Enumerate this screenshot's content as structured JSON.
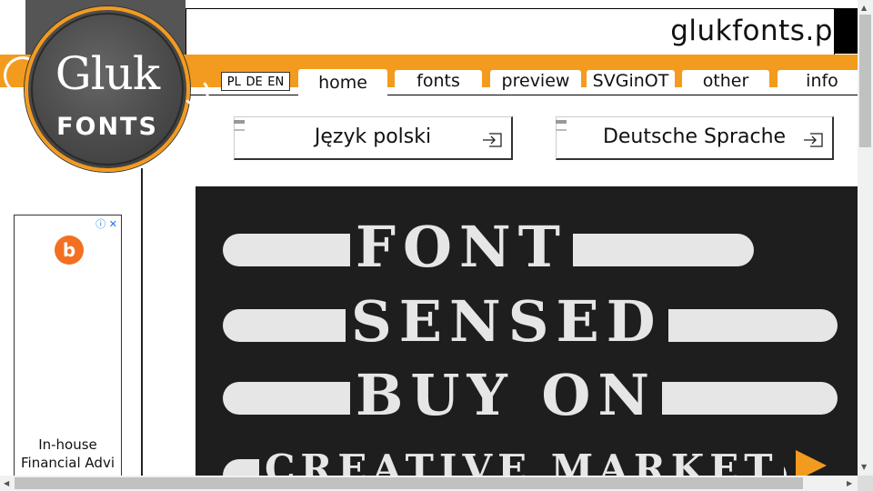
{
  "header": {
    "site_title": "glukfonts.p",
    "title_overflow": "pl"
  },
  "logo": {
    "word1": "Gluk",
    "word2": "FONTS"
  },
  "languages": [
    "PL",
    "DE",
    "EN"
  ],
  "tabs": [
    {
      "label": "home",
      "active": true
    },
    {
      "label": "fonts",
      "active": false
    },
    {
      "label": "preview",
      "active": false
    },
    {
      "label": "SVGinOT",
      "active": false
    },
    {
      "label": "other",
      "active": false
    },
    {
      "label": "info",
      "active": false
    }
  ],
  "language_buttons": {
    "polish": "Język polski",
    "german": "Deutsche Sprache"
  },
  "ad": {
    "info_close": "ⓘ ✕",
    "logo_glyph": "b",
    "text": "In-house Financial Advi"
  },
  "banner": {
    "line1": "FONT",
    "line2": "SENSED",
    "line3": "BUY ON",
    "line4": "CREATIVE MARKET"
  },
  "colors": {
    "accent": "#f39b1f",
    "banner_bg": "#1e1e1e",
    "banner_fg": "#e6e6e6"
  },
  "icons": {
    "enter": "enter-icon",
    "play": "play-icon"
  }
}
